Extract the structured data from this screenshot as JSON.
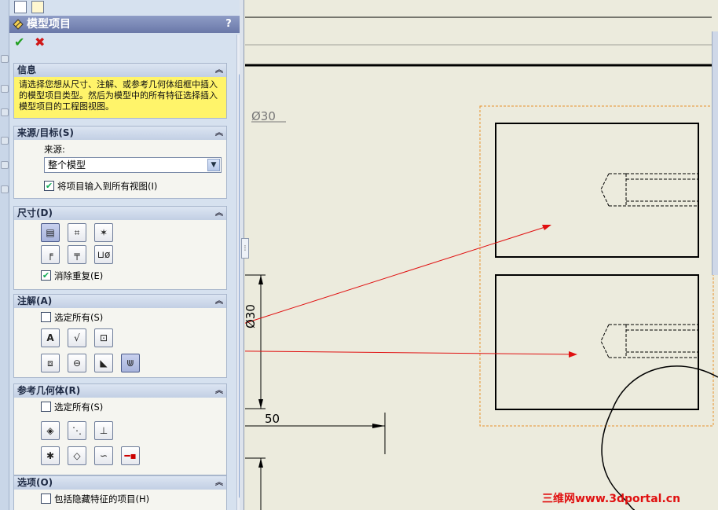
{
  "panel": {
    "title": "模型项目",
    "help": "?",
    "ok": "✔",
    "cancel": "✖"
  },
  "info": {
    "header": "信息",
    "text": "请选择您想从尺寸、注解、或参考几何体组框中插入的模型项目类型。然后为模型中的所有特征选择插入模型项目的工程图视图。"
  },
  "source": {
    "header": "来源/目标(S)",
    "source_label": "来源:",
    "source_value": "整个模型",
    "import_all_label": "将项目输入到所有视图(I)",
    "import_all_checked": true
  },
  "dimensions": {
    "header": "尺寸(D)",
    "eliminate_dup_label": "消除重复(E)",
    "eliminate_dup_checked": true
  },
  "annotations": {
    "header": "注解(A)",
    "select_all_label": "选定所有(S)",
    "select_all_checked": false
  },
  "refgeom": {
    "header": "参考几何体(R)",
    "select_all_label": "选定所有(S)",
    "select_all_checked": false
  },
  "options": {
    "header": "选项(O)",
    "hidden_label": "包括隐藏特征的项目(H)",
    "hidden_checked": false
  },
  "drawing": {
    "dim_phi30_top": "Ø30",
    "dim_50": "50",
    "dim_phi30_side": "Ø30",
    "watermark": "三维网www.3dportal.cn"
  },
  "colors": {
    "annotation_red": "#e01010",
    "view_border_orange": "#e8902a",
    "info_yellow": "#fff46a",
    "title_bar": "#7886b4"
  }
}
